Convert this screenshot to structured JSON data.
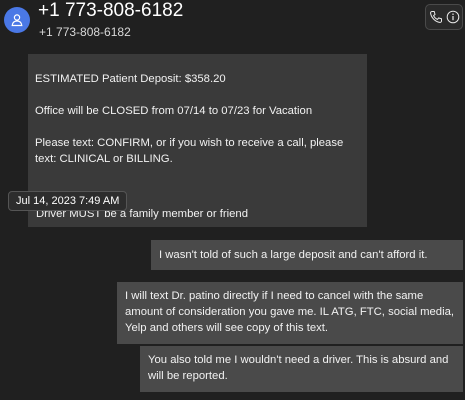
{
  "header": {
    "title": "+1 773-808-6182",
    "subtitle": "+1 773-808-6182",
    "avatar_icon": "person-icon",
    "call_icon": "phone-icon",
    "info_icon": "info-icon",
    "accent_color": "#4a78e6"
  },
  "messages": {
    "incoming_1": {
      "line1": "ESTIMATED Patient Deposit: $358.20",
      "line2": "Office will be CLOSED from 07/14 to 07/23 for Vacation",
      "line3": "Please text: CONFIRM, or if you wish to receive a call, please text: CLINICAL or BILLING.",
      "line4": "Driver MUST be a family member or friend"
    },
    "timestamp_tooltip": "Jul 14, 2023 7:49 AM",
    "outgoing_1": "I wasn't told of such a large deposit and can't afford it.",
    "outgoing_2": "I will text Dr. patino directly if I need to cancel with the same amount of consideration you gave me.  IL ATG, FTC, social media, Yelp and others will see copy of this text.",
    "outgoing_3": "You also told me I wouldn't need a driver.  This is absurd and will be reported."
  }
}
